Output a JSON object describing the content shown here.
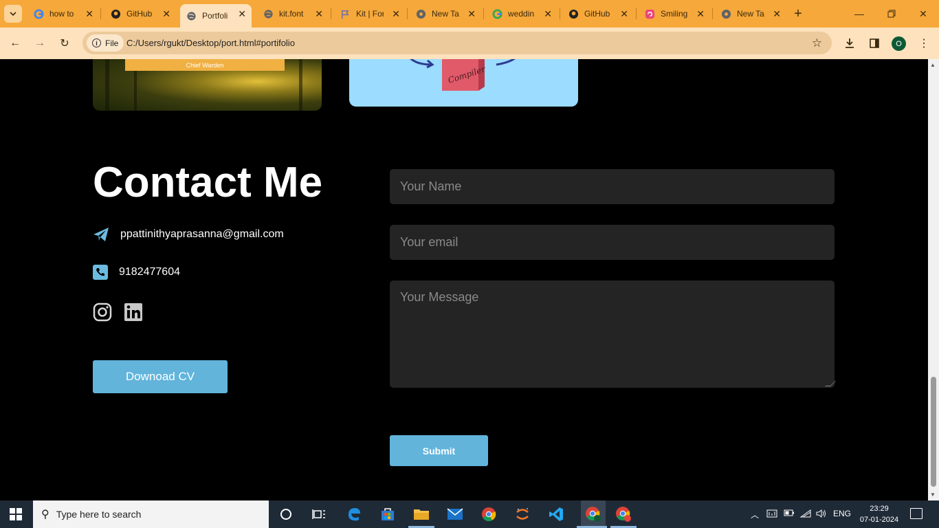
{
  "browser": {
    "tabs": [
      {
        "label": "how to",
        "icon": "google-icon",
        "active": false
      },
      {
        "label": "GitHub",
        "icon": "github-icon",
        "active": false
      },
      {
        "label": "Portfoli",
        "icon": "globe-icon",
        "active": true
      },
      {
        "label": "kit.font",
        "icon": "globe-icon",
        "active": false
      },
      {
        "label": "Kit | For",
        "icon": "flag-icon",
        "active": false
      },
      {
        "label": "New Ta",
        "icon": "chrome-icon",
        "active": false
      },
      {
        "label": "weddin",
        "icon": "google-icon",
        "active": false
      },
      {
        "label": "GitHub",
        "icon": "github-icon",
        "active": false
      },
      {
        "label": "Smiling",
        "icon": "spiral-icon",
        "active": false
      },
      {
        "label": "New Ta",
        "icon": "chrome-icon",
        "active": false
      }
    ],
    "site_chip": "File",
    "url": "C:/Users/rgukt/Desktop/port.html#portifolio",
    "profile_initial": "O"
  },
  "page": {
    "card_label": "Chief Warden",
    "compiler_label": "Compiler",
    "contact_title": "Contact Me",
    "email": "ppattinithyaprasanna@gmail.com",
    "phone": "9182477604",
    "download_cv": "Downoad CV",
    "form": {
      "name_placeholder": "Your Name",
      "email_placeholder": "Your email",
      "message_placeholder": "Your Message",
      "submit": "Submit"
    },
    "colors": {
      "accent": "#62b4db",
      "field_bg": "#242424",
      "background": "#000000"
    }
  },
  "taskbar": {
    "search_placeholder": "Type here to search",
    "language": "ENG",
    "time": "23:29",
    "date": "07-01-2024"
  }
}
